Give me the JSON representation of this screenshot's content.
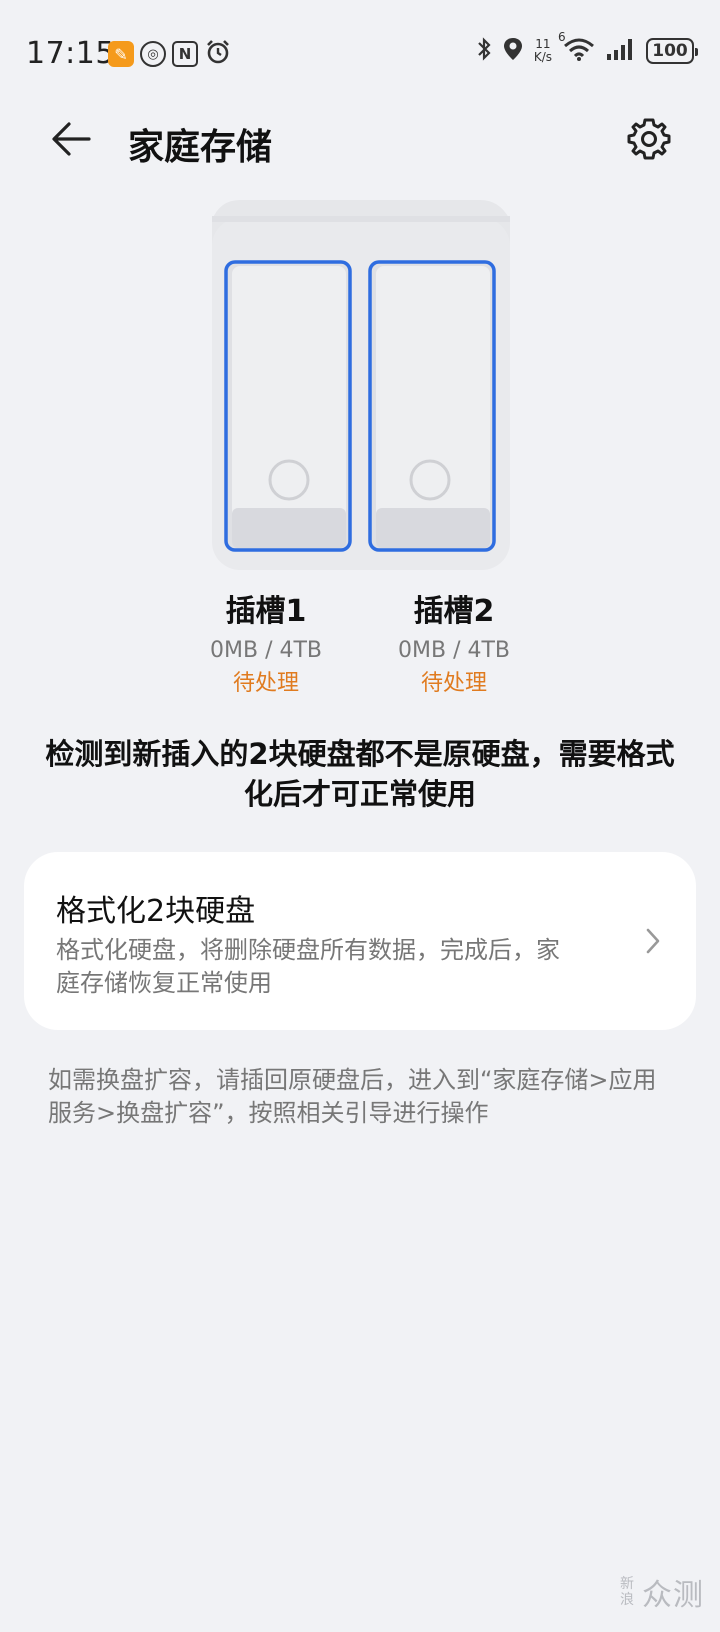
{
  "status_bar": {
    "time": "17:15",
    "speed_top": "11",
    "speed_unit": "K/s",
    "signal_type": "6",
    "battery": "100"
  },
  "header": {
    "title": "家庭存储"
  },
  "slots": [
    {
      "name": "插槽1",
      "capacity": "0MB / 4TB",
      "status": "待处理"
    },
    {
      "name": "插槽2",
      "capacity": "0MB / 4TB",
      "status": "待处理"
    }
  ],
  "notice": "检测到新插入的2块硬盘都不是原硬盘，需要格式化后才可正常使用",
  "format_card": {
    "title": "格式化2块硬盘",
    "description": "格式化硬盘，将删除硬盘所有数据，完成后，家庭存储恢复正常使用"
  },
  "hint": "如需换盘扩容，请插回原硬盘后，进入到“家庭存储>应用服务>换盘扩容”，按照相关引导进行操作",
  "watermark": {
    "small": "新浪",
    "big": "众测"
  },
  "colors": {
    "background": "#f1f2f5",
    "slot_highlight": "#2f6de0",
    "status_orange": "#e07b1f",
    "secondary_text": "#777777"
  }
}
